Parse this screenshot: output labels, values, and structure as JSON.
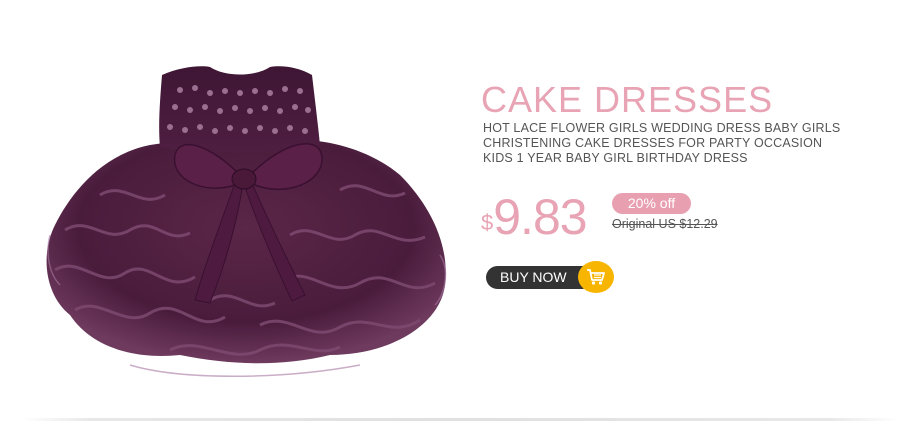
{
  "product": {
    "title": "CAKE DRESSES",
    "description_lines": [
      "HOT LACE FLOWER GIRLS WEDDING DRESS BABY GIRLS",
      "CHRISTENING CAKE DRESSES FOR PARTY OCCASION",
      "KIDS 1 YEAR BABY GIRL BIRTHDAY DRESS"
    ]
  },
  "pricing": {
    "currency_symbol": "$",
    "price": "9.83",
    "discount": "20% off",
    "original": "Original  US $12.29"
  },
  "cta": {
    "label": "BUY NOW",
    "icon": "shopping-cart-icon"
  },
  "colors": {
    "accent_pink": "#e8a4b4",
    "dress_purple": "#4a1c3c",
    "button_dark": "#333333",
    "cart_yellow": "#f7b500"
  }
}
